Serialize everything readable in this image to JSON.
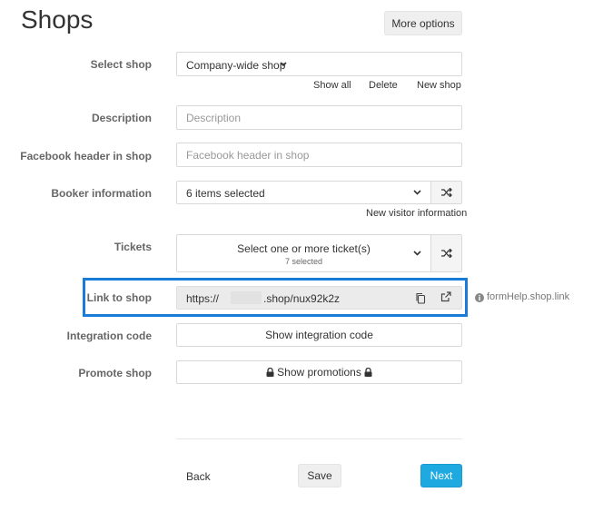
{
  "page": {
    "title": "Shops"
  },
  "header": {
    "more_options": "More options"
  },
  "select_shop": {
    "label": "Select shop",
    "value": "Company-wide shop",
    "links": [
      "Show all",
      "Delete",
      "New shop"
    ]
  },
  "description": {
    "label": "Description",
    "placeholder": "Description"
  },
  "facebook_header": {
    "label": "Facebook header in shop",
    "placeholder": "Facebook header in shop"
  },
  "booker_info": {
    "label": "Booker information",
    "value": "6 items selected",
    "link": "New visitor information"
  },
  "tickets": {
    "label": "Tickets",
    "value": "Select one or more ticket(s)",
    "sub": "7 selected"
  },
  "link_to_shop": {
    "label": "Link to shop",
    "url_prefix": "https://",
    "url_suffix": ".shop/nux92k2z",
    "help": "formHelp.shop.link"
  },
  "integration": {
    "label": "Integration code",
    "button": "Show integration code"
  },
  "promote": {
    "label": "Promote shop",
    "button": "Show promotions"
  },
  "footer": {
    "back": "Back",
    "save": "Save",
    "next": "Next"
  },
  "colors": {
    "primary": "#1fa9e1",
    "highlight_border": "#1a7bd8",
    "field_border": "#d9d9d9"
  },
  "icons": [
    "chevron-down-icon",
    "shuffle-icon",
    "copy-icon",
    "external-link-icon",
    "info-icon",
    "lock-icon"
  ]
}
